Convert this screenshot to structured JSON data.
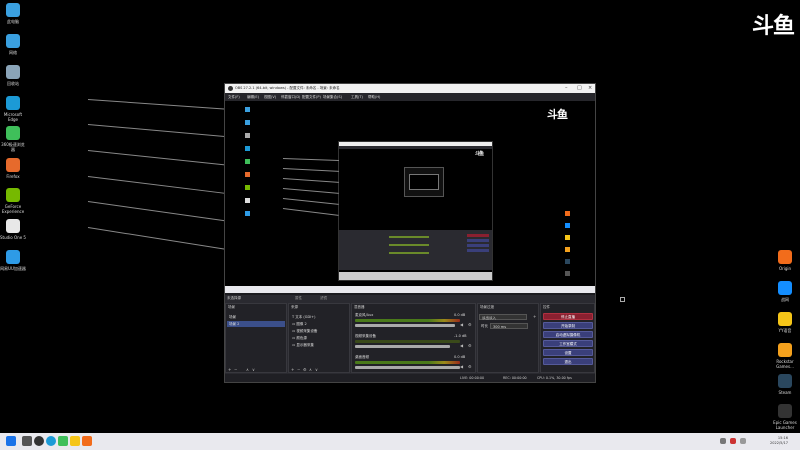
{
  "desktop_icons": [
    {
      "label": "此电脑",
      "icon": "computer-icon",
      "color": "#3aa0e0"
    },
    {
      "label": "网络",
      "icon": "network-icon",
      "color": "#3aa0e0"
    },
    {
      "label": "回收站",
      "icon": "recycle-bin-icon",
      "color": "#8aa4b8"
    },
    {
      "label": "Microsoft Edge",
      "icon": "edge-icon",
      "color": "#1c9ad6"
    },
    {
      "label": "360极速浏览器",
      "icon": "browser-360-icon",
      "color": "#3fbf5a"
    },
    {
      "label": "Firefox",
      "icon": "firefox-icon",
      "color": "#e66a2c"
    },
    {
      "label": "GeForce Experience",
      "icon": "geforce-icon",
      "color": "#76b900"
    },
    {
      "label": "Studio One 5",
      "icon": "studio-one-icon",
      "color": "#e8e8e8"
    },
    {
      "label": "网易UU加速器",
      "icon": "uu-icon",
      "color": "#2e9be6"
    }
  ],
  "right_icons": [
    {
      "label": "Origin",
      "icon": "origin-icon",
      "color": "#f26c1b"
    },
    {
      "label": "战网",
      "icon": "battlenet-icon",
      "color": "#148eff"
    },
    {
      "label": "YY语音",
      "icon": "yy-icon",
      "color": "#f5c518"
    },
    {
      "label": "Rockstar Games...",
      "icon": "rockstar-icon",
      "color": "#f4a11d"
    },
    {
      "label": "Steam",
      "icon": "steam-icon",
      "color": "#2a475e"
    },
    {
      "label": "Epic Games Launcher",
      "icon": "epic-icon",
      "color": "#333333"
    }
  ],
  "watermark": "斗鱼",
  "obs": {
    "title": "OBS 27.2.1 (64-bit, windows) - 配置文件: 未命名 - 场景: 未命名",
    "menu": [
      "文件(F)",
      "编辑(E)",
      "视图(V)",
      "停靠窗口(D)",
      "配置文件(P)",
      "场景集合(S)",
      "工具(T)",
      "帮助(H)"
    ],
    "scene_info": "未选择源",
    "properties": "属性",
    "filters": "滤镜",
    "scenes": {
      "title": "场景",
      "items": [
        "场景",
        "场景 2"
      ]
    },
    "sources": {
      "title": "来源",
      "items": [
        "文本 (GDI+)",
        "图像 2",
        "视频采集设备",
        "颜色源",
        "显示器采集"
      ]
    },
    "mixer": {
      "title": "混音器",
      "channels": [
        {
          "name": "麦克风/Aux",
          "db": "0.0 dB"
        },
        {
          "name": "视频采集设备",
          "db": "-1.0 dB"
        },
        {
          "name": "桌面音频",
          "db": "0.0 dB"
        }
      ]
    },
    "transitions": {
      "title": "场景过渡",
      "type": "淡出淡入",
      "duration_label": "时长",
      "duration_value": "300 ms"
    },
    "controls": {
      "title": "控件",
      "buttons": [
        "停止直播",
        "开始录制",
        "启动虚拟摄像机",
        "工作室模式",
        "设置",
        "退出"
      ]
    },
    "status": {
      "live": "LIVE: 00:00:00",
      "rec": "REC: 00:00:00",
      "cpu": "CPU: 0.1%, 30.00 fps"
    }
  },
  "taskbar": {
    "time": "15:16",
    "date": "2022/5/17"
  }
}
